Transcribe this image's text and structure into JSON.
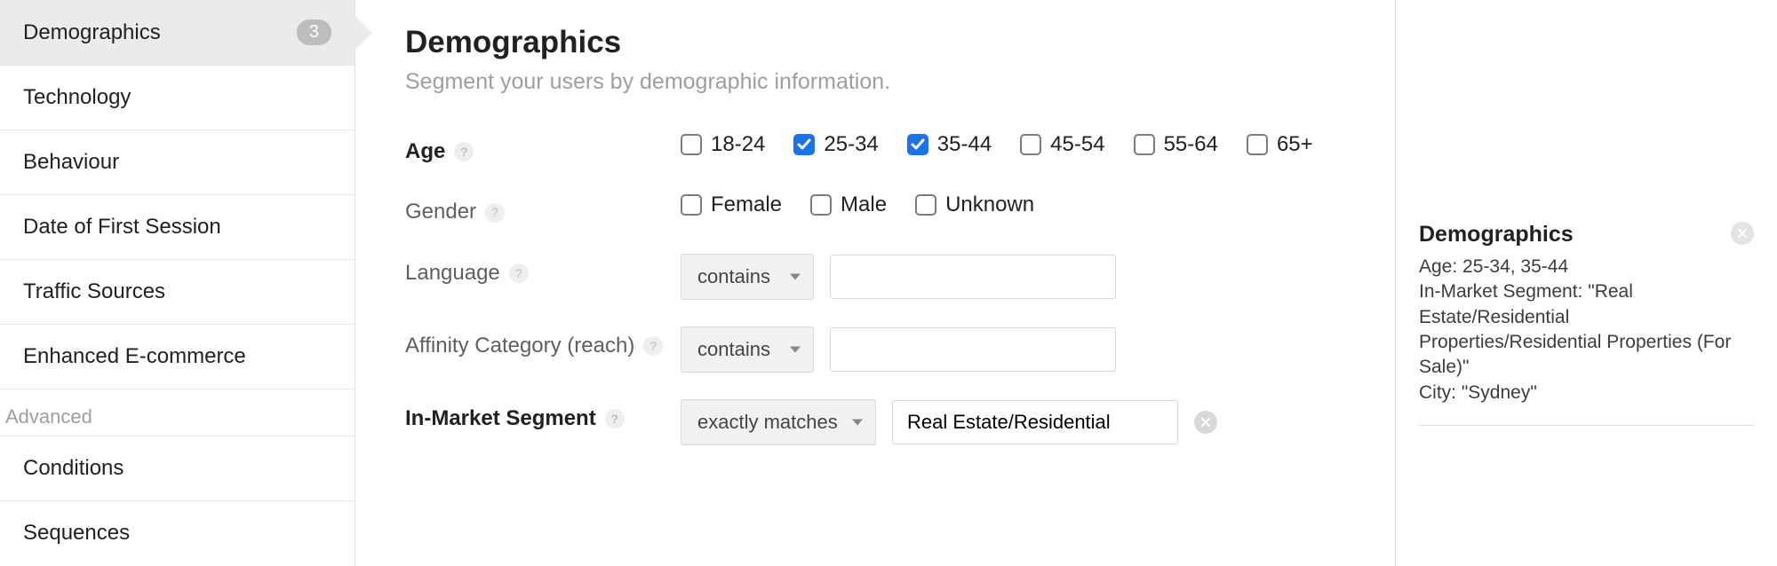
{
  "sidebar": {
    "active_badge": "3",
    "items": [
      {
        "label": "Demographics",
        "active": true
      },
      {
        "label": "Technology"
      },
      {
        "label": "Behaviour"
      },
      {
        "label": "Date of First Session"
      },
      {
        "label": "Traffic Sources"
      },
      {
        "label": "Enhanced E-commerce"
      }
    ],
    "advanced_header": "Advanced",
    "advanced_items": [
      {
        "label": "Conditions"
      },
      {
        "label": "Sequences"
      }
    ]
  },
  "main": {
    "title": "Demographics",
    "subtitle": "Segment your users by demographic information.",
    "rows": {
      "age": {
        "label": "Age",
        "options": [
          {
            "label": "18-24",
            "checked": false
          },
          {
            "label": "25-34",
            "checked": true
          },
          {
            "label": "35-44",
            "checked": true
          },
          {
            "label": "45-54",
            "checked": false
          },
          {
            "label": "55-64",
            "checked": false
          },
          {
            "label": "65+",
            "checked": false
          }
        ]
      },
      "gender": {
        "label": "Gender",
        "options": [
          {
            "label": "Female",
            "checked": false
          },
          {
            "label": "Male",
            "checked": false
          },
          {
            "label": "Unknown",
            "checked": false
          }
        ]
      },
      "language": {
        "label": "Language",
        "operator": "contains",
        "value": ""
      },
      "affinity": {
        "label": "Affinity Category (reach)",
        "operator": "contains",
        "value": ""
      },
      "inmarket": {
        "label": "In-Market Segment",
        "operator": "exactly matches",
        "value": "Real Estate/Residential"
      }
    }
  },
  "summary": {
    "title": "Demographics",
    "lines": [
      "Age: 25-34, 35-44",
      "In-Market Segment: \"Real Estate/Residential Properties/Residential Properties (For Sale)\"",
      "City: \"Sydney\""
    ]
  }
}
